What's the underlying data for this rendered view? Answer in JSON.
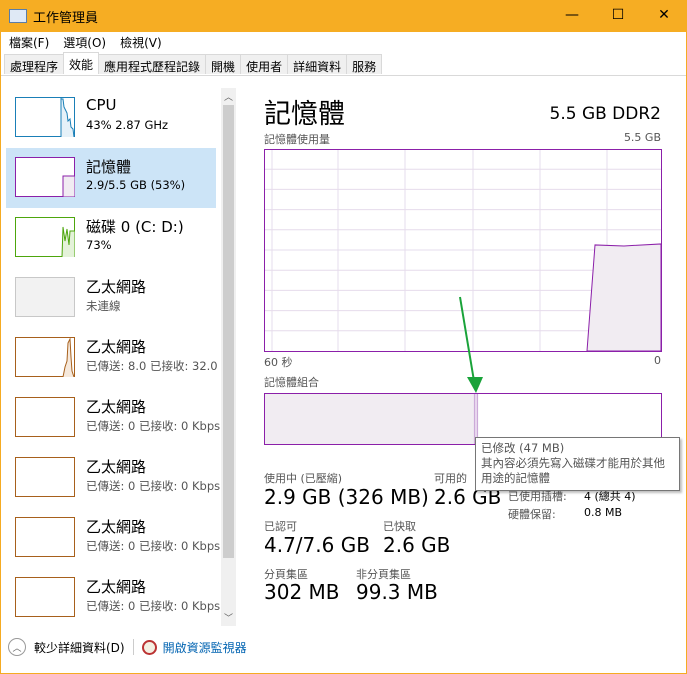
{
  "window": {
    "title": "工作管理員",
    "minimize": "—",
    "maximize": "☐",
    "close": "✕"
  },
  "menu": [
    "檔案(F)",
    "選項(O)",
    "檢視(V)"
  ],
  "tabs": [
    "處理程序",
    "效能",
    "應用程式歷程記錄",
    "開機",
    "使用者",
    "詳細資料",
    "服務"
  ],
  "active_tab": 1,
  "sidebar": [
    {
      "name": "CPU",
      "sub": "43%  2.87 GHz",
      "color": "#1a7fb7"
    },
    {
      "name": "記憶體",
      "sub": "2.9/5.5 GB (53%)",
      "color": "#8b1fa9"
    },
    {
      "name": "磁碟 0 (C: D:)",
      "sub": "73%",
      "color": "#4da60c"
    },
    {
      "name": "乙太網路",
      "sub": "未連線",
      "color": "#c8c8c8"
    },
    {
      "name": "乙太網路",
      "sub": "已傳送: 8.0 已接收: 32.0",
      "color": "#a7601c"
    },
    {
      "name": "乙太網路",
      "sub": "已傳送: 0 已接收: 0 Kbps",
      "color": "#a7601c"
    },
    {
      "name": "乙太網路",
      "sub": "已傳送: 0 已接收: 0 Kbps",
      "color": "#a7601c"
    },
    {
      "name": "乙太網路",
      "sub": "已傳送: 0 已接收: 0 Kbps",
      "color": "#a7601c"
    },
    {
      "name": "乙太網路",
      "sub": "已傳送: 0 已接收: 0 Kbps",
      "color": "#a7601c"
    }
  ],
  "main": {
    "title": "記憶體",
    "spec": "5.5 GB DDR2",
    "usage_label": "記憶體使用量",
    "usage_max": "5.5 GB",
    "time_left": "60 秒",
    "time_right": "0",
    "composition_label": "記憶體組合",
    "usage_fraction_recent": 0.53,
    "composition": {
      "in_use_fraction": 0.53,
      "modified_fraction": 0.008
    },
    "stats": {
      "in_use_label": "使用中 (已壓縮)",
      "in_use": "2.9 GB (326 MB)",
      "available_label": "可用的",
      "available": "2.6 GB",
      "committed_label": "已認可",
      "committed": "4.7/7.6 GB",
      "cached_label": "已快取",
      "cached": "2.6 GB",
      "paged_label": "分頁集區",
      "paged": "302 MB",
      "nonpaged_label": "非分頁集區",
      "nonpaged": "99.3 MB",
      "slots_label": "已使用插槽:",
      "slots": "4 (總共 4)",
      "reserved_label": "硬體保留:",
      "reserved": "0.8 MB"
    },
    "tooltip": {
      "title": "已修改 (47 MB)",
      "body": "其內容必須先寫入磁碟才能用於其他用途的記憶體"
    }
  },
  "footer": {
    "fewer_details": "較少詳細資料(D)",
    "open_monitor": "開啟資源監視器"
  },
  "colors": {
    "titlebar": "#f6ad23",
    "memory": "#8b1fa9",
    "selection": "#cce4f7",
    "annotation_arrow": "#1aa33a"
  }
}
